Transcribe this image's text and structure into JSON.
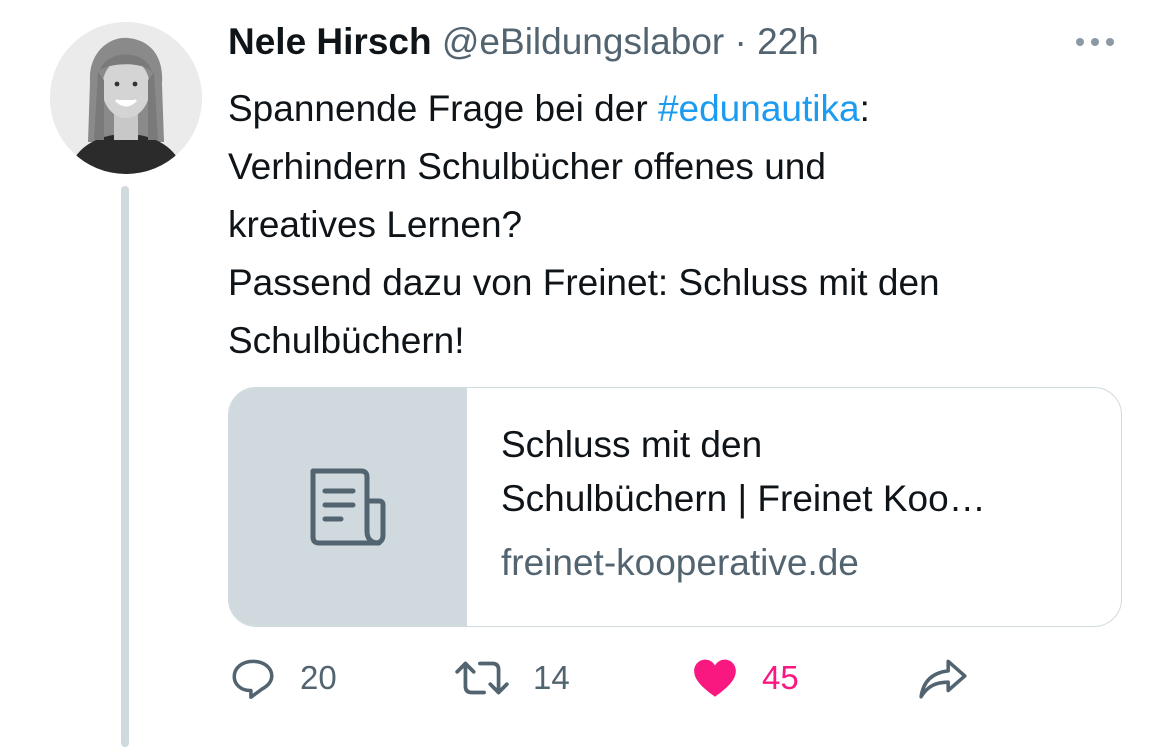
{
  "tweet": {
    "author_name": "Nele Hirsch",
    "author_handle": "@eBildungslabor",
    "separator": "·",
    "time": "22h",
    "text": {
      "line1_pre": "Spannende Frage bei der ",
      "hashtag": "#edunautika",
      "line1_post": ":",
      "line2": "Verhindern Schulbücher offenes und",
      "line3": "kreatives Lernen?",
      "line4": "Passend dazu von Freinet: Schluss mit den",
      "line5": "Schulbüchern!"
    },
    "link_card": {
      "title_line1": "Schluss mit den",
      "title_line2": "Schulbüchern | Freinet Koo…",
      "domain": "freinet-kooperative.de",
      "thumbnail_icon": "document-icon"
    },
    "actions": {
      "reply_count": "20",
      "retweet_count": "14",
      "like_count": "45",
      "like_color": "#f91880"
    }
  },
  "icons": {
    "more": "more-icon",
    "reply": "reply-icon",
    "retweet": "retweet-icon",
    "like": "heart-icon",
    "share": "share-icon"
  }
}
